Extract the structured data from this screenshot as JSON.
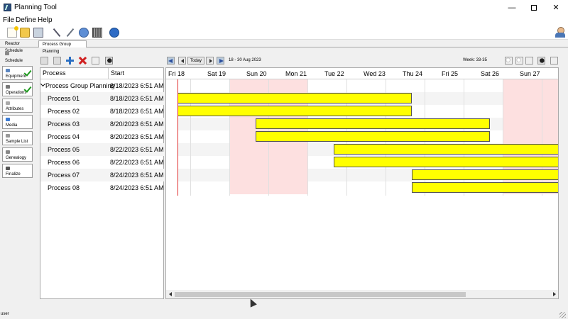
{
  "window": {
    "title": "Planning Tool",
    "minimize": "—",
    "close": "✕"
  },
  "menu": {
    "file": "File",
    "define": "Define",
    "help": "Help"
  },
  "tabs": {
    "reactor_schedule": "Reactor Schedule",
    "process_group_planning": "Process Group Planning"
  },
  "nav": {
    "schedule": "Schedule",
    "equipment": "Equipment",
    "operations": "Operations",
    "attributes": "Attributes",
    "media": "Media",
    "sample_list": "Sample List",
    "genealogy": "Genealogy",
    "finalize": "Finalize"
  },
  "grid": {
    "columns": {
      "process": "Process",
      "start": "Start"
    },
    "group": {
      "name": "Process Group Planning",
      "start": "8/18/2023 6:51 AM"
    },
    "rows": [
      {
        "name": "Process  01",
        "start": "8/18/2023 6:51 AM"
      },
      {
        "name": "Process  02",
        "start": "8/18/2023 6:51 AM"
      },
      {
        "name": "Process  03",
        "start": "8/20/2023 6:51 AM"
      },
      {
        "name": "Process  04",
        "start": "8/20/2023 6:51 AM"
      },
      {
        "name": "Process  05",
        "start": "8/22/2023 6:51 AM"
      },
      {
        "name": "Process  06",
        "start": "8/22/2023 6:51 AM"
      },
      {
        "name": "Process  07",
        "start": "8/24/2023 6:51 AM"
      },
      {
        "name": "Process  08",
        "start": "8/24/2023 6:51 AM"
      }
    ]
  },
  "timeline": {
    "today_label": "Today",
    "date_range": "18 - 30 Aug 2023",
    "week_range": "Week: 33-35",
    "days": [
      "Fri 18",
      "Sat 19",
      "Sun 20",
      "Mon 21",
      "Tue 22",
      "Wed 23",
      "Thu 24",
      "Fri 25",
      "Sat 26",
      "Sun 27"
    ],
    "weekend_indices": [
      1,
      2,
      8,
      9
    ]
  },
  "status": {
    "user": "user"
  },
  "colors": {
    "bar": "#ffff00",
    "weekend": "#fde0e0",
    "now_line": "#e03030"
  }
}
